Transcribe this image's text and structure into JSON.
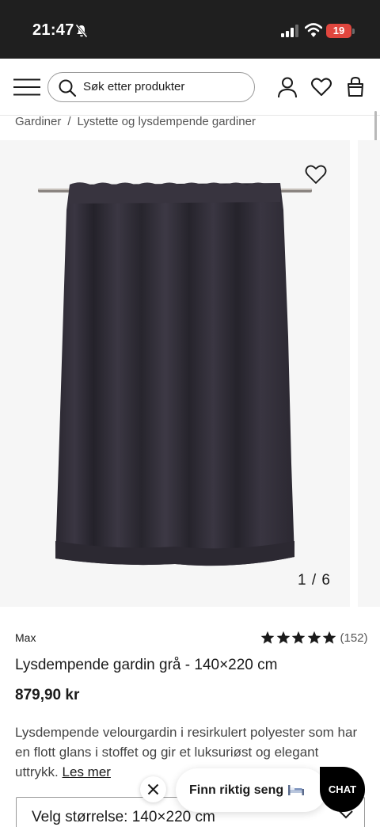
{
  "status_bar": {
    "time": "21:47",
    "battery": "19",
    "icons": [
      "bell-muted-icon",
      "signal-icon",
      "wifi-icon",
      "battery-icon"
    ]
  },
  "header": {
    "search_placeholder": "Søk etter produkter",
    "icons": [
      "menu-icon",
      "search-icon",
      "user-icon",
      "heart-icon",
      "bag-icon"
    ]
  },
  "breadcrumb": {
    "items": [
      "Gardiner",
      "Lystette og lysdempende gardiner"
    ],
    "separator": "/"
  },
  "gallery": {
    "counter": "1 / 6",
    "current": 1,
    "total": 6,
    "curtain_color": "#2f2c35"
  },
  "product": {
    "brand": "Max",
    "rating": 5,
    "rating_count": "(152)",
    "title": "Lysdempende gardin grå - 140×220 cm",
    "price": "879,90 kr",
    "description": "Lysdempende velourgardin i resirkulert polyester som har en flott glans i stoffet og gir et luksuriøst og elegant uttrykk.",
    "read_more": "Les mer"
  },
  "size_select": {
    "label": "Velg størrelse: 140×220 cm"
  },
  "floating": {
    "bed_finder": "Finn riktig seng",
    "chat": "CHAT"
  },
  "colors": {
    "status_bar": "#1f1f1f",
    "battery_low": "#e0463e",
    "gallery_bg": "#f6f6f6",
    "star": "#1a1a1a"
  }
}
